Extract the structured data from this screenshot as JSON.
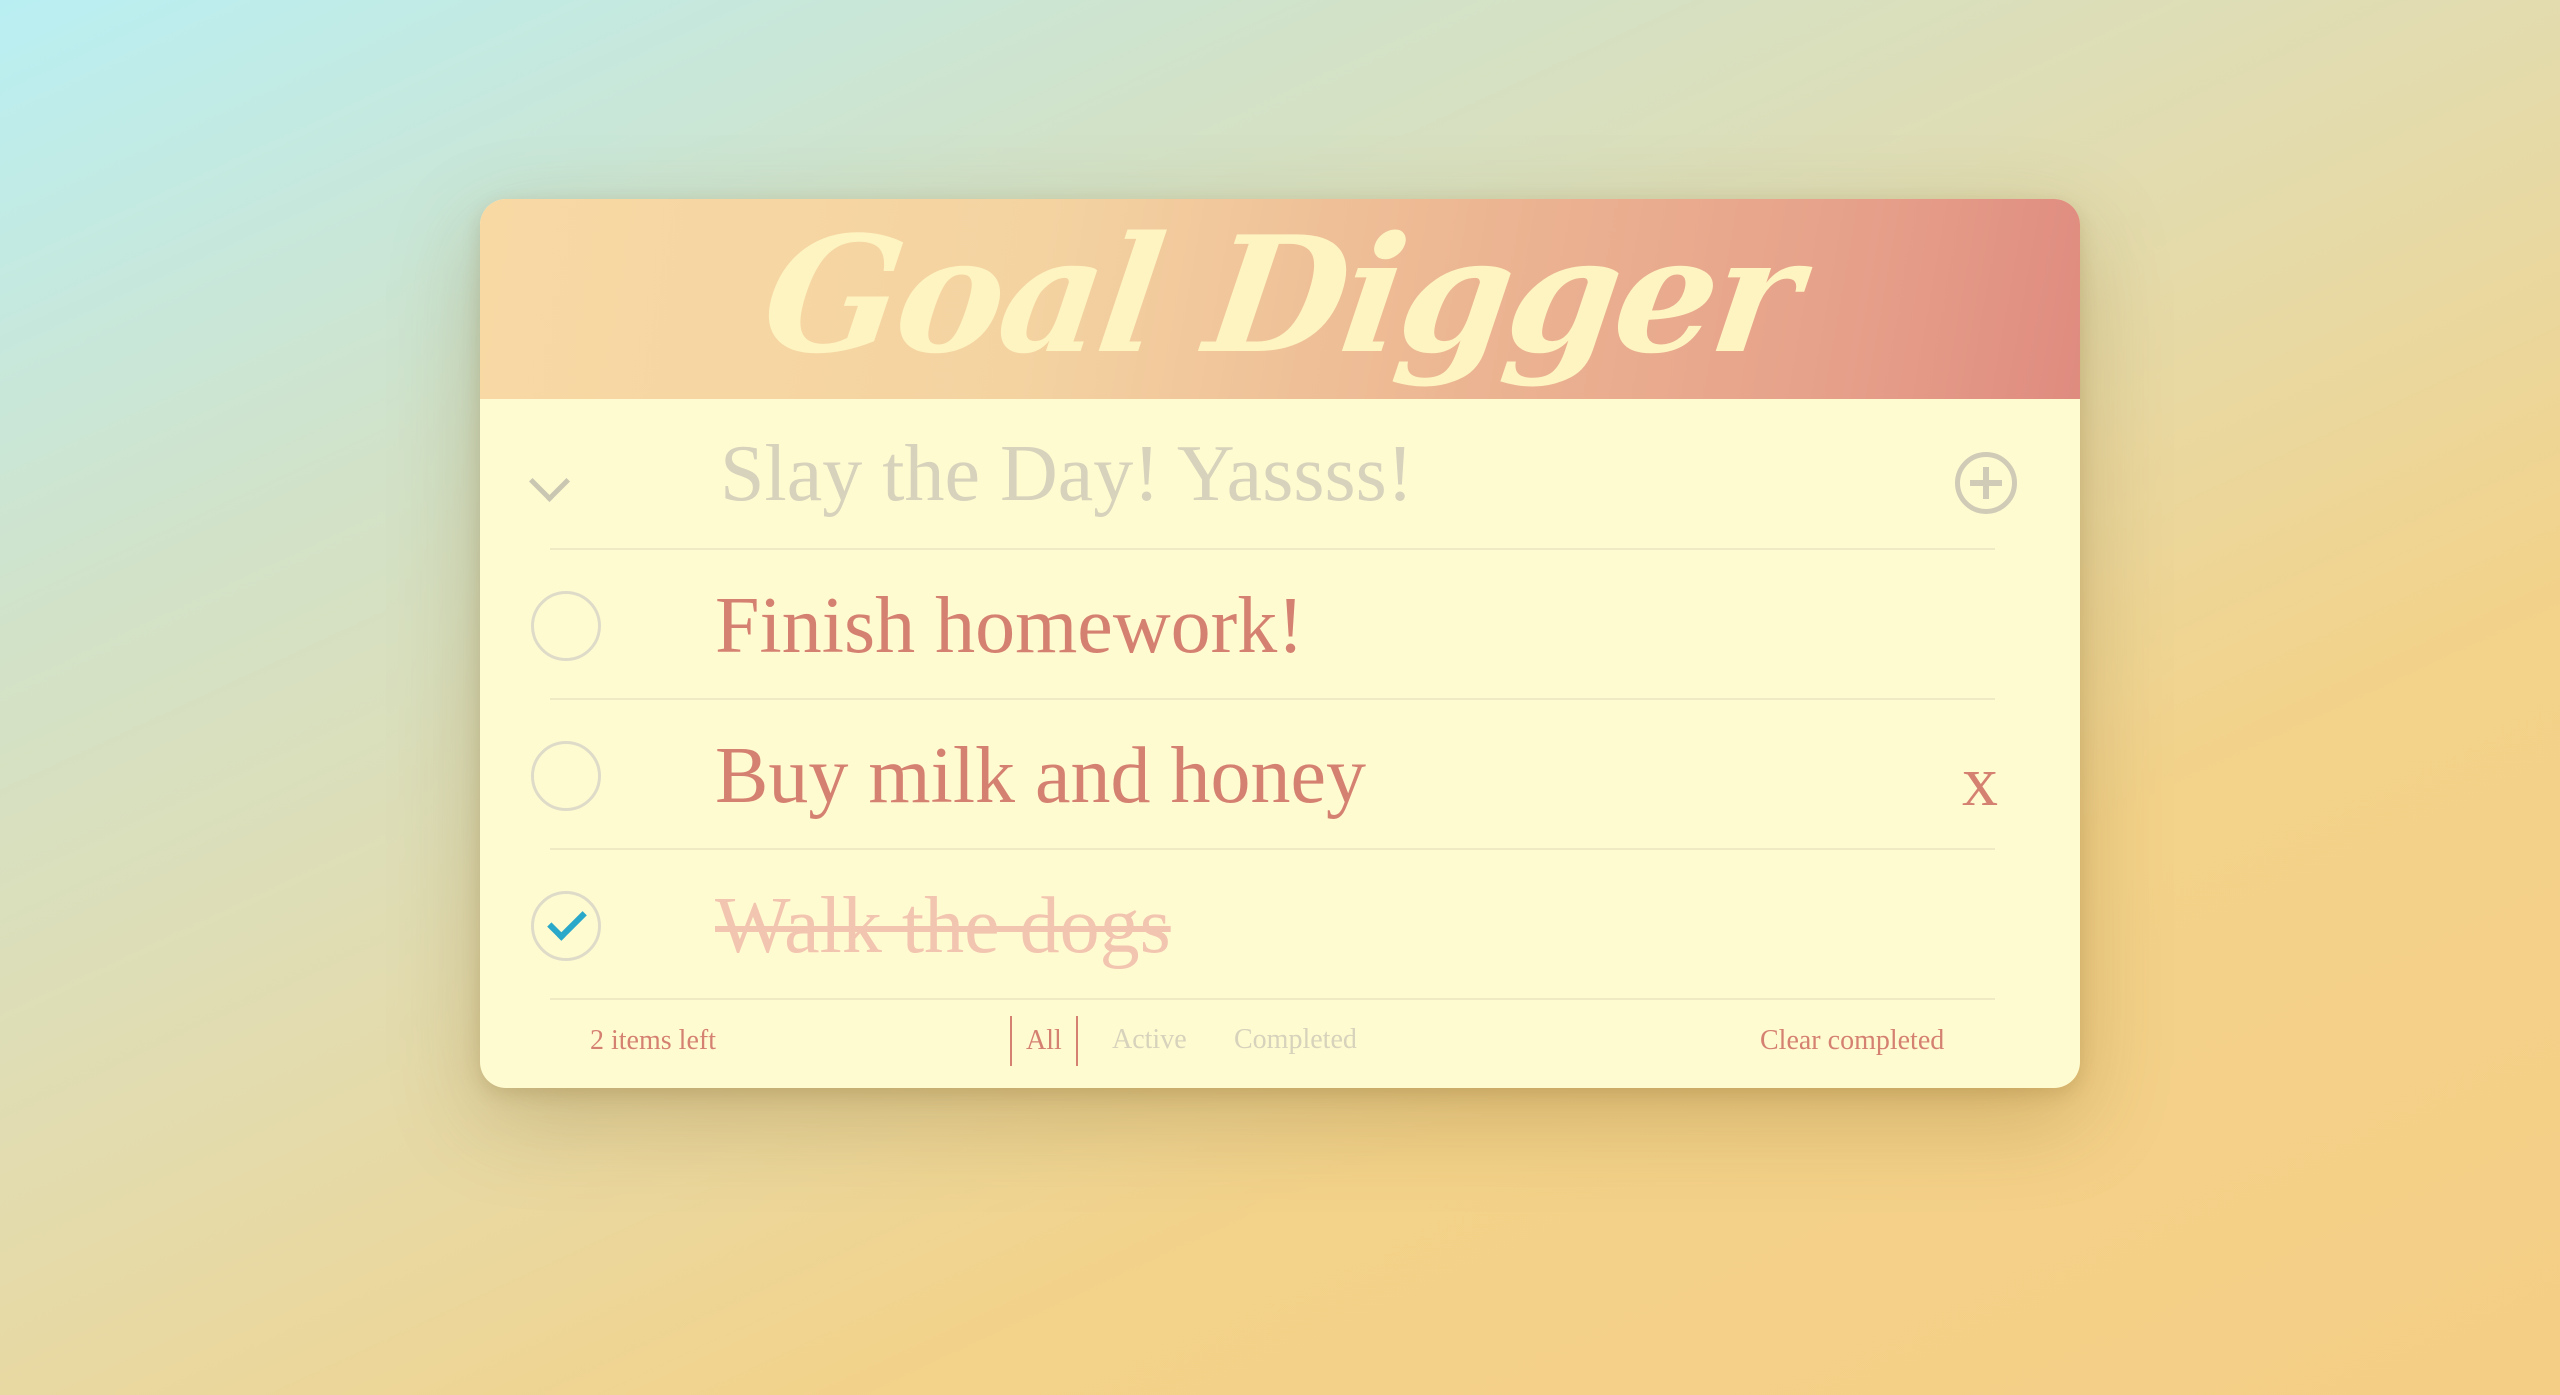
{
  "app": {
    "title": "Goal Digger"
  },
  "new_todo": {
    "placeholder": "Slay the Day! Yassss!",
    "value": ""
  },
  "todos": [
    {
      "label": "Finish homework!",
      "completed": false
    },
    {
      "label": "Buy milk and honey",
      "completed": false,
      "destroy_label": "x"
    },
    {
      "label": "Walk the dogs",
      "completed": true
    }
  ],
  "footer": {
    "items_left": "2 items left",
    "filters": [
      "All",
      "Active",
      "Completed"
    ],
    "selected_filter": "All",
    "clear_label": "Clear completed"
  },
  "colors": {
    "accent": "#d58171",
    "placeholder": "#d6d2bc",
    "checkmark": "#2aa8c9",
    "card": "#fffbd0"
  }
}
